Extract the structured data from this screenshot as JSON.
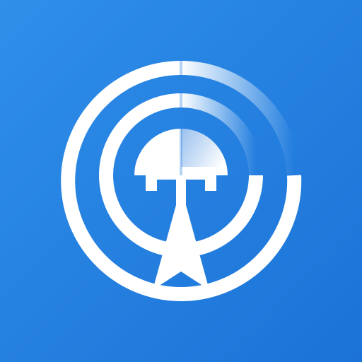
{
  "icon": {
    "name": "broadcast-tower-icon",
    "background_top": "#2f8fe9",
    "background_bottom": "#1b72d7",
    "foreground": "#ffffff",
    "accent": "#d9e8f9"
  }
}
